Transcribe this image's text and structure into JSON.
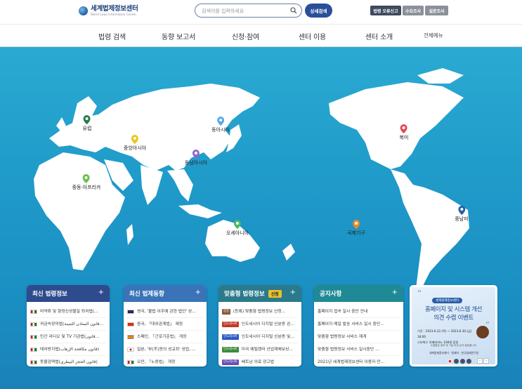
{
  "header": {
    "logo_name": "세계법제정보센터",
    "logo_sub": "World Laws Information Center",
    "search_placeholder": "검색어를 입력하세요",
    "advanced_search": "상세검색",
    "quick_buttons": [
      "법령 오류신고",
      "수요조사",
      "설문조사"
    ]
  },
  "nav": {
    "items": [
      "법령 검색",
      "동향 보고서",
      "신청·참여",
      "센터 이용",
      "센터 소개"
    ],
    "all_menu": "전체메뉴"
  },
  "map": {
    "regions": [
      {
        "label": "유럽",
        "color": "#2b7a4b"
      },
      {
        "label": "중앙아시아",
        "color": "#f0c419"
      },
      {
        "label": "동아시아",
        "color": "#5aa9e6"
      },
      {
        "label": "동남아시아",
        "color": "#8e6ac8"
      },
      {
        "label": "중동·아프리카",
        "color": "#6cc04a"
      },
      {
        "label": "오세아니아",
        "color": "#4cb86a"
      },
      {
        "label": "국제기구",
        "color": "#f08a24"
      },
      {
        "label": "북미",
        "color": "#e14b5a"
      },
      {
        "label": "중남미",
        "color": "#2a5ea8"
      }
    ]
  },
  "panels": [
    {
      "title": "최신 법령정보",
      "color": "#2d4b8d",
      "items": [
        {
          "flag": "om",
          "text": "마약류 및 향정신성물질 퇴치법(…"
        },
        {
          "flag": "om",
          "text": "귀금속광미법(قانون المعادن الثمينة…"
        },
        {
          "flag": "om",
          "text": "민간 라디오 및 TV 기관법(قانون…"
        },
        {
          "flag": "om",
          "text": "테러방지법(قانون مكافحة الإرهاب)"
        },
        {
          "flag": "om",
          "text": "동물검역법(قانون الحجر البيطري)"
        }
      ]
    },
    {
      "title": "최신 법제동향",
      "color": "#3a73b8",
      "items": [
        {
          "flag": "gb",
          "text": "영국, '불법 이주에 관한 법안' 상…"
        },
        {
          "flag": "cn",
          "text": "중국, 「대외관계법」 제정"
        },
        {
          "flag": "es",
          "text": "스페인, 「근로기준법」 개정"
        },
        {
          "flag": "jp",
          "text": "일본, '부(不)동의 성교죄' 성립, …"
        },
        {
          "flag": "om",
          "text": "오만, 「노동법」 개정"
        }
      ]
    },
    {
      "title": "맞춤형 법령정보",
      "tag": "신청",
      "color": "#2b7a8c",
      "items": [
        {
          "badge": "몽골",
          "badge_color": "#8b5a3c",
          "text": "(등록) 맞춤형 법령정보 신청…"
        },
        {
          "badge": "인도네시아",
          "badge_color": "#c0392b",
          "text": "인도네시아 디지털 신분증 관…"
        },
        {
          "badge": "인도네시아",
          "badge_color": "#2b59c3",
          "text": "인도네시아 디지털 신분증 및…"
        },
        {
          "badge": "인도네시아",
          "badge_color": "#3d8b3d",
          "text": "미국 에틸렌러 산업재해보상…"
        },
        {
          "badge": "인도네시아",
          "badge_color": "#6b4db5",
          "text": "베트남 의료 광고법"
        }
      ]
    },
    {
      "title": "공지사항",
      "color": "#1f8a96",
      "items": [
        {
          "text": "홈페이지 접속 일시 중단 안내"
        },
        {
          "text": "홈페이지 메일 발송 서비스 일시 중단…"
        },
        {
          "text": "맞춤형 법령정보 서비스 재개"
        },
        {
          "text": "맞춤형 법령정보 서비스 일시중단 …"
        },
        {
          "text": "2021년 세계법제정보센터 이용자 만…"
        }
      ]
    }
  ],
  "banner": {
    "pill": "세계법제정보센터",
    "title1": "홈페이지 및 시스템 개선",
    "title2": "의견 수렴 이벤트",
    "period": "기간 : 2023.6.22.(목) ~ 2023.6.30.(금) 18:00",
    "prize": "스타벅스 아메리카노 100명 증정",
    "note": "※경품은 응모 후 7일 이내 순차 발송합니다",
    "logos": "세계법제정보센터 · 법제처 · 한국법제연구원"
  },
  "slider": {
    "prev": "‹",
    "next": "›"
  }
}
